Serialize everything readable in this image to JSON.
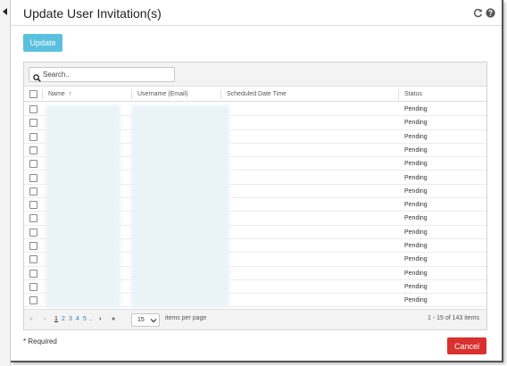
{
  "dialog": {
    "title": "Update User Invitation(s)",
    "icons": [
      "refresh-icon",
      "help-icon"
    ]
  },
  "toolbar": {
    "update_label": "Update"
  },
  "search": {
    "placeholder": "Search.."
  },
  "columns": {
    "name": "Name",
    "name_sort": "↑",
    "username": "Username (Email)",
    "scheduled": "Scheduled Date Time",
    "status": "Status"
  },
  "rows": [
    {
      "status": "Pending"
    },
    {
      "status": "Pending"
    },
    {
      "status": "Pending"
    },
    {
      "status": "Pending"
    },
    {
      "status": "Pending"
    },
    {
      "status": "Pending"
    },
    {
      "status": "Pending"
    },
    {
      "status": "Pending"
    },
    {
      "status": "Pending"
    },
    {
      "status": "Pending"
    },
    {
      "status": "Pending"
    },
    {
      "status": "Pending"
    },
    {
      "status": "Pending"
    },
    {
      "status": "Pending"
    },
    {
      "status": "Pending"
    }
  ],
  "pager": {
    "first": "«",
    "prev": "‹",
    "pages": [
      "1",
      "2",
      "3",
      "4",
      "5"
    ],
    "ellipsis": "..",
    "next": "›",
    "last": "»",
    "page_size": "15",
    "items_per_page": "items per page",
    "count_text": "1 - 15 of 143 items"
  },
  "footer": {
    "required_note": "*  Required",
    "cancel_label": "Cancel"
  },
  "colors": {
    "update_button": "#5bc0de",
    "cancel_button": "#d9312e",
    "page_link": "#2d7fb8"
  }
}
